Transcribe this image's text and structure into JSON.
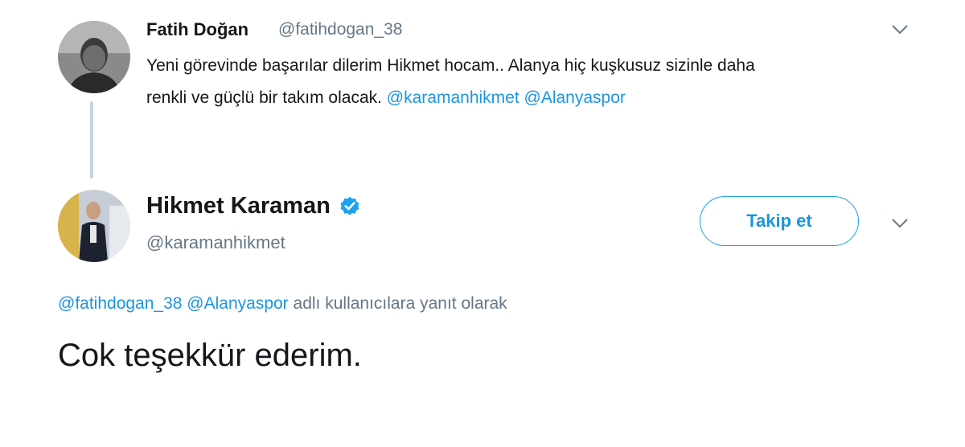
{
  "parent_tweet": {
    "author_name": "Fatih Doğan",
    "author_handle": "@fatihdogan_38",
    "text_line1": "Yeni görevinde başarılar dilerim Hikmet hocam.. Alanya hiç kuşkusuz sizinle daha",
    "text_line2_prefix": "renkli ve güçlü bir takım olacak. ",
    "mention1": "@karamanhikmet",
    "mention2": "@Alanyaspor",
    "caret_icon": "chevron-down-icon"
  },
  "reply_author": {
    "name": "Hikmet Karaman",
    "handle": "@karamanhikmet",
    "verified_icon": "verified-badge-icon",
    "follow_label": "Takip et",
    "caret_icon": "chevron-down-icon"
  },
  "reply_context": {
    "mention1": "@fatihdogan_38",
    "mention2": "@Alanyaspor",
    "suffix": "adlı kullanıcılara yanıt olarak"
  },
  "reply_tweet": {
    "text": "Cok teşekkür ederim."
  },
  "colors": {
    "link": "#1b95e0",
    "secondary_text": "#657786",
    "primary_text": "#14171a",
    "thread_line": "#c4d6e6",
    "verified": "#1da1f2"
  }
}
